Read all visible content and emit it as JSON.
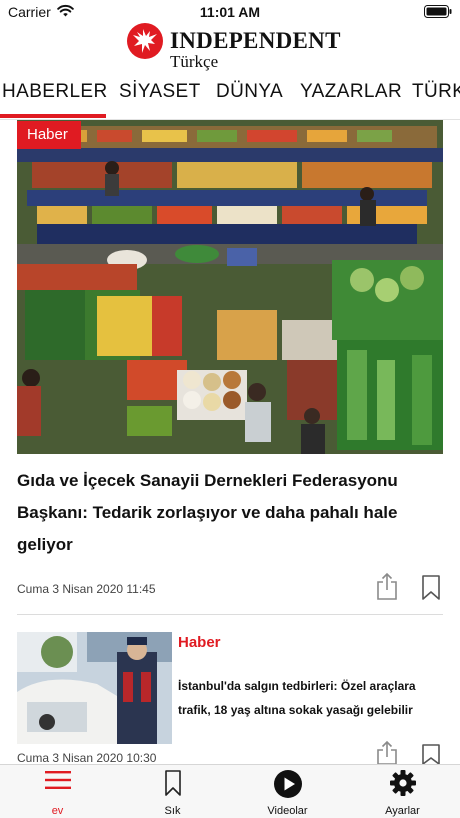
{
  "status_bar": {
    "carrier": "Carrier",
    "time": "11:01 AM"
  },
  "header": {
    "logo_title": "INDEPENDENT",
    "logo_subtitle": "Türkçe"
  },
  "tabs": [
    {
      "label": "HABERLER",
      "active": true
    },
    {
      "label": "SİYASET"
    },
    {
      "label": "DÜNYA"
    },
    {
      "label": "YAZARLAR"
    },
    {
      "label": "TÜRK"
    }
  ],
  "featured": {
    "badge": "Haber",
    "title": "Gıda ve İçecek Sanayii Dernekleri Federasyonu Başkanı: Tedarik zorlaşıyor ve daha pahalı hale geliyor",
    "date": "Cuma 3 Nisan 2020 11:45"
  },
  "article": {
    "category": "Haber",
    "title": "İstanbul'da salgın tedbirleri: Özel araçlara trafik, 18 yaş altına sokak yasağı gelebilir",
    "date": "Cuma 3 Nisan 2020 10:30"
  },
  "tabbar": [
    {
      "label": "ev",
      "icon": "menu-icon",
      "active": true
    },
    {
      "label": "Sık",
      "icon": "bookmark-icon"
    },
    {
      "label": "Videolar",
      "icon": "play-icon"
    },
    {
      "label": "Ayarlar",
      "icon": "gear-icon"
    }
  ],
  "colors": {
    "accent": "#e01b22",
    "tabbar_bg": "#f7f7f7"
  }
}
